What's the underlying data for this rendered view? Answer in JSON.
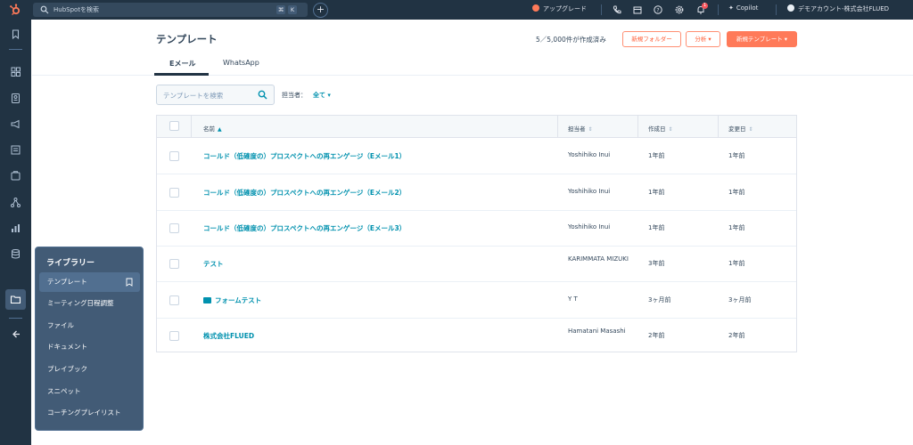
{
  "topbar": {
    "search_placeholder": "HubSpotを検索",
    "kbd_cmd": "⌘",
    "kbd_k": "K",
    "plus": "+",
    "upgrade_label": "アップグレード",
    "copilot_label": "Copilot",
    "account_label": "デモアカウント-株式会社FLUED",
    "notification_count": "1"
  },
  "page": {
    "title": "テンプレート",
    "count_text": "5／5,000件が作成済み",
    "new_folder_button": "新規フォルダー",
    "analyze_button": "分析 ▾",
    "new_template_button": "新規テンプレート ▾"
  },
  "tabs": [
    {
      "label": "Eメール",
      "active": true
    },
    {
      "label": "WhatsApp",
      "active": false
    }
  ],
  "filters": {
    "search_placeholder": "テンプレートを検索",
    "owner_label": "担当者：",
    "owner_value": "全て ▾"
  },
  "table": {
    "columns": {
      "name": "名前",
      "owner": "担当者",
      "created": "作成日",
      "updated": "変更日"
    },
    "rows": [
      {
        "name": "コールド（低確度の）プロスペクトへの再エンゲージ（Eメール1）",
        "owner": "Yoshihiko Inui",
        "created": "1年前",
        "updated": "1年前"
      },
      {
        "name": "コールド（低確度の）プロスペクトへの再エンゲージ（Eメール2）",
        "owner": "Yoshihiko Inui",
        "created": "1年前",
        "updated": "1年前"
      },
      {
        "name": "コールド（低確度の）プロスペクトへの再エンゲージ（Eメール3）",
        "owner": "Yoshihiko Inui",
        "created": "1年前",
        "updated": "1年前"
      },
      {
        "name": "テスト",
        "owner": "KARIMMATA MIZUKI",
        "created": "3年前",
        "updated": "1年前"
      },
      {
        "name": "フォームテスト",
        "owner": "Y T",
        "created": "3ヶ月前",
        "updated": "3ヶ月前"
      },
      {
        "name": "株式会社FLUED",
        "owner": "Hamatani Masashi",
        "created": "2年前",
        "updated": "2年前"
      }
    ]
  },
  "library_menu": {
    "title": "ライブラリー",
    "items": [
      {
        "label": "テンプレート",
        "active": true
      },
      {
        "label": "ミーティング日程調整",
        "active": false
      },
      {
        "label": "ファイル",
        "active": false
      },
      {
        "label": "ドキュメント",
        "active": false
      },
      {
        "label": "プレイブック",
        "active": false
      },
      {
        "label": "スニペット",
        "active": false
      },
      {
        "label": "コーチングプレイリスト",
        "active": false
      }
    ]
  },
  "colors": {
    "nav_bg": "#213343",
    "accent": "#ff7a59",
    "link": "#0091ae"
  }
}
